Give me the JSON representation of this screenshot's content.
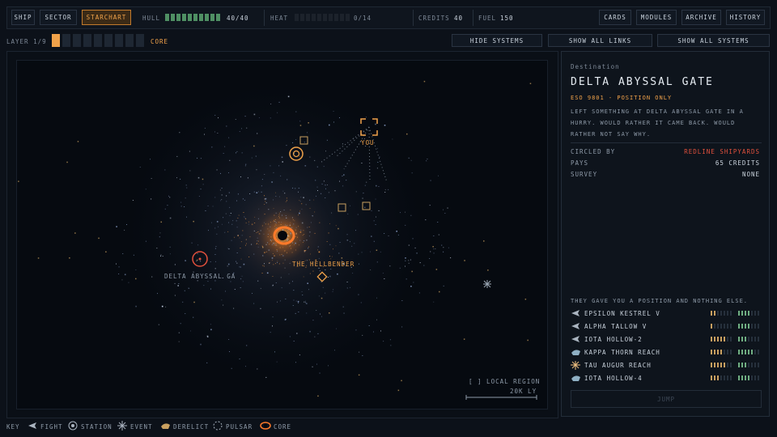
{
  "nav": {
    "ship": "SHIP",
    "sector": "SECTOR",
    "starchart": "STARCHART",
    "cards": "CARDS",
    "modules": "MODULES",
    "archive": "ARCHIVE",
    "history": "HISTORY"
  },
  "stats": {
    "hull_label": "HULL",
    "hull_value": "40/40",
    "hull_fraction": 1.0,
    "heat_label": "HEAT",
    "heat_value": "0/14",
    "heat_fraction": 0,
    "credits_label": "CREDITS",
    "credits_value": "40",
    "fuel_label": "FUEL",
    "fuel_value": "150"
  },
  "layer": {
    "label": "LAYER 1/9",
    "current": 1,
    "total": 9,
    "name": "CORE"
  },
  "toggles": {
    "hide_systems": "HIDE SYSTEMS",
    "show_all_links": "SHOW ALL LINKS",
    "show_all_systems": "SHOW ALL SYSTEMS"
  },
  "map": {
    "you_label": "YOU",
    "core_label": "THE HELLBENDER",
    "destination_label": "DELTA ABYSSAL GA",
    "region_label": "[ ] LOCAL REGION",
    "scale_label": "20K LY"
  },
  "destination": {
    "heading": "Destination",
    "name": "DELTA ABYSSAL GATE",
    "subtitle": "ESO 9801 - POSITION ONLY",
    "description": "LEFT SOMETHING AT DELTA ABYSSAL GATE IN A HURRY. WOULD RATHER IT CAME BACK. WOULD RATHER NOT SAY WHY.",
    "fields": [
      {
        "label": "CIRCLED BY",
        "value": "REDLINE SHIPYARDS",
        "highlight": true
      },
      {
        "label": "PAYS",
        "value": "65 CREDITS",
        "highlight": false
      },
      {
        "label": "SURVEY",
        "value": "NONE",
        "highlight": false
      }
    ],
    "list_heading": "THEY GAVE YOU A POSITION AND NOTHING ELSE.",
    "systems": [
      {
        "name": "EPSILON KESTREL V",
        "icon": "fight-icon",
        "a": 2,
        "b": 4
      },
      {
        "name": "ALPHA TALLOW V",
        "icon": "fight-icon",
        "a": 1,
        "b": 4
      },
      {
        "name": "IOTA HOLLOW-2",
        "icon": "fight-icon",
        "a": 5,
        "b": 3
      },
      {
        "name": "KAPPA THORN REACH",
        "icon": "derelict-icon",
        "a": 4,
        "b": 5
      },
      {
        "name": "TAU AUGUR REACH",
        "icon": "event-icon",
        "a": 5,
        "b": 3
      },
      {
        "name": "IOTA HOLLOW-4",
        "icon": "derelict-icon",
        "a": 3,
        "b": 4
      }
    ],
    "jump_label": "JUMP"
  },
  "legend": {
    "key": "KEY",
    "fight": "FIGHT",
    "station": "STATION",
    "event": "EVENT",
    "derelict": "DERELICT",
    "pulsar": "PULSAR",
    "core": "CORE"
  },
  "colors": {
    "accent": "#f0a24a",
    "danger": "#e0503c",
    "hull": "#4f8f63",
    "text": "#c9d2dc"
  }
}
